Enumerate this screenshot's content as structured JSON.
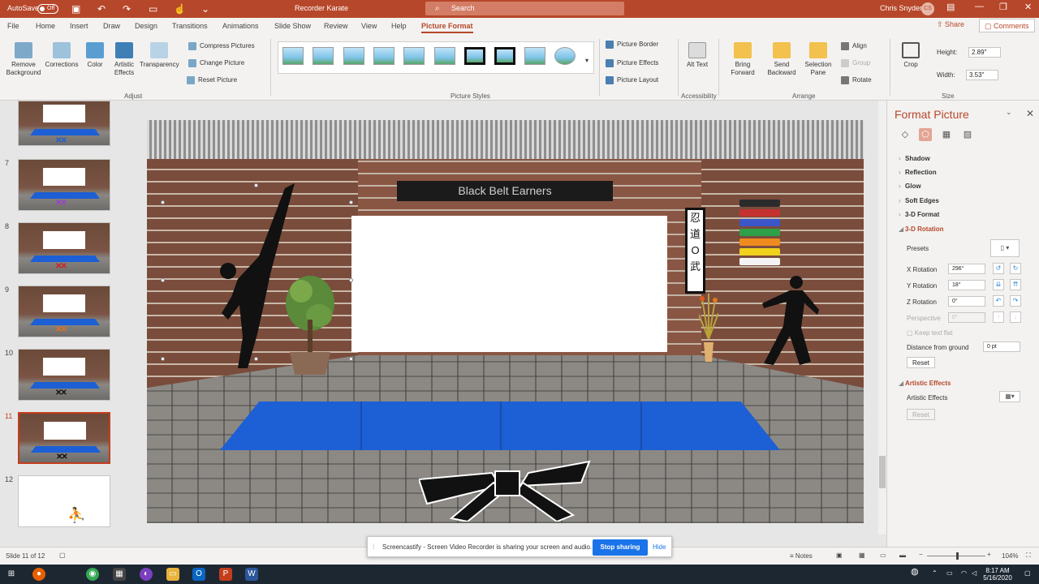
{
  "titlebar": {
    "autosave": "AutoSave",
    "autosave_state": "Off",
    "doc_title": "Recorder Karate",
    "search_placeholder": "Search",
    "user": "Chris Snyder",
    "initials": "CS"
  },
  "tabs": [
    "File",
    "Home",
    "Insert",
    "Draw",
    "Design",
    "Transitions",
    "Animations",
    "Slide Show",
    "Review",
    "View",
    "Help",
    "Picture Format"
  ],
  "share": "Share",
  "comments": "Comments",
  "ribbon": {
    "remove_bg": "Remove Background",
    "corrections": "Corrections",
    "color": "Color",
    "artistic": "Artistic Effects",
    "transparency": "Transparency",
    "compress": "Compress Pictures",
    "change": "Change Picture",
    "reset": "Reset Picture",
    "adjust": "Adjust",
    "border": "Picture Border",
    "effects": "Picture Effects",
    "layout": "Picture Layout",
    "styles": "Picture Styles",
    "alt": "Alt Text",
    "accessibility": "Accessibility",
    "bring": "Bring Forward",
    "send": "Send Backward",
    "selection": "Selection Pane",
    "align": "Align",
    "group": "Group",
    "rotate": "Rotate",
    "arrange": "Arrange",
    "crop": "Crop",
    "height_label": "Height:",
    "height": "2.89\"",
    "width_label": "Width:",
    "width": "3.53\"",
    "size": "Size"
  },
  "thumbs": [
    {
      "num": "7",
      "bow": "purple"
    },
    {
      "num": "8",
      "bow": "red"
    },
    {
      "num": "9",
      "bow": "orange"
    },
    {
      "num": "10",
      "bow": "black"
    },
    {
      "num": "11",
      "bow": "black"
    },
    {
      "num": "12",
      "bow": ""
    }
  ],
  "slide": {
    "banner": "Black Belt Earners",
    "scroll_chars": "忍 道 O 武"
  },
  "pane": {
    "title": "Format Picture",
    "sections": [
      "Shadow",
      "Reflection",
      "Glow",
      "Soft Edges",
      "3-D Format",
      "3-D Rotation"
    ],
    "presets": "Presets",
    "x_label": "X Rotation",
    "x_val": "296°",
    "y_label": "Y Rotation",
    "y_val": "18°",
    "z_label": "Z Rotation",
    "z_val": "0°",
    "persp_label": "Perspective",
    "persp_val": "0°",
    "keep_flat": "Keep text flat",
    "distance_label": "Distance from ground",
    "distance_val": "0 pt",
    "reset": "Reset",
    "artistic_section": "Artistic Effects",
    "artistic_label": "Artistic Effects",
    "reset2": "Reset"
  },
  "status": {
    "slide": "Slide 11 of 12",
    "notes": "Notes",
    "zoom": "104%"
  },
  "toast": {
    "message": "Screencastify - Screen Video Recorder is sharing your screen and audio.",
    "stop": "Stop sharing",
    "hide": "Hide"
  },
  "taskbar": {
    "time": "8:17 AM",
    "date": "5/16/2020"
  },
  "colors": {
    "accent": "#b7472a",
    "mat": "#1d5fd4"
  }
}
